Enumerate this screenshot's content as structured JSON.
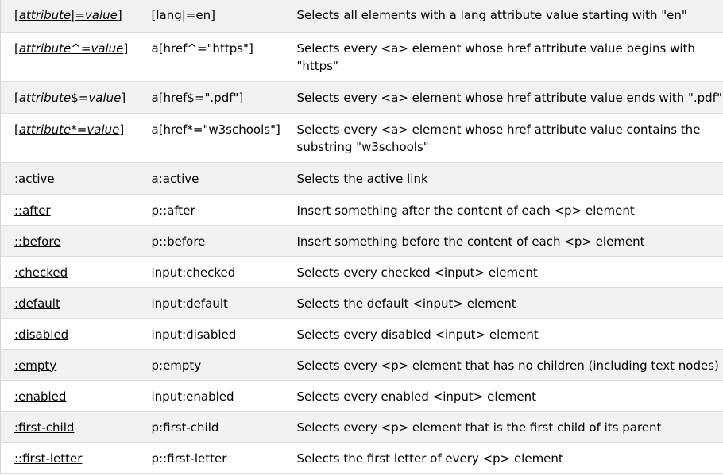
{
  "rows": [
    {
      "selector_pre": "[",
      "selector_italic1": "attribute",
      "selector_mid": "|=",
      "selector_italic2": "value",
      "selector_post": "]",
      "example": "[lang|=en]",
      "description": "Selects all elements with a lang attribute value starting with \"en\""
    },
    {
      "selector_pre": "[",
      "selector_italic1": "attribute",
      "selector_mid": "^=",
      "selector_italic2": "value",
      "selector_post": "]",
      "example": "a[href^=\"https\"]",
      "description": "Selects every <a> element whose href attribute value begins with \"https\""
    },
    {
      "selector_pre": "[",
      "selector_italic1": "attribute",
      "selector_mid": "$=",
      "selector_italic2": "value",
      "selector_post": "]",
      "example": "a[href$=\".pdf\"]",
      "description": "Selects every <a> element whose href attribute value ends with \".pdf\""
    },
    {
      "selector_pre": "[",
      "selector_italic1": "attribute",
      "selector_mid": "*=",
      "selector_italic2": "value",
      "selector_post": "]",
      "example": "a[href*=\"w3schools\"]",
      "description": "Selects every <a> element whose href attribute value contains the substring \"w3schools\""
    },
    {
      "selector": ":active",
      "example": "a:active",
      "description": "Selects the active link"
    },
    {
      "selector": "::after",
      "example": "p::after",
      "description": "Insert something after the content of each <p> element"
    },
    {
      "selector": "::before",
      "example": "p::before",
      "description": "Insert something before the content of each <p> element"
    },
    {
      "selector": ":checked",
      "example": "input:checked",
      "description": "Selects every checked <input> element"
    },
    {
      "selector": ":default",
      "example": "input:default",
      "description": "Selects the default <input> element"
    },
    {
      "selector": ":disabled",
      "example": "input:disabled",
      "description": "Selects every disabled <input> element"
    },
    {
      "selector": ":empty",
      "example": "p:empty",
      "description": "Selects every <p> element that has no children (including text nodes)"
    },
    {
      "selector": ":enabled",
      "example": "input:enabled",
      "description": "Selects every enabled <input> element"
    },
    {
      "selector": ":first-child",
      "example": "p:first-child",
      "description": "Selects every <p> element that is the first child of its parent"
    },
    {
      "selector": "::first-letter",
      "example": "p::first-letter",
      "description": "Selects the first letter of every <p> element"
    }
  ]
}
